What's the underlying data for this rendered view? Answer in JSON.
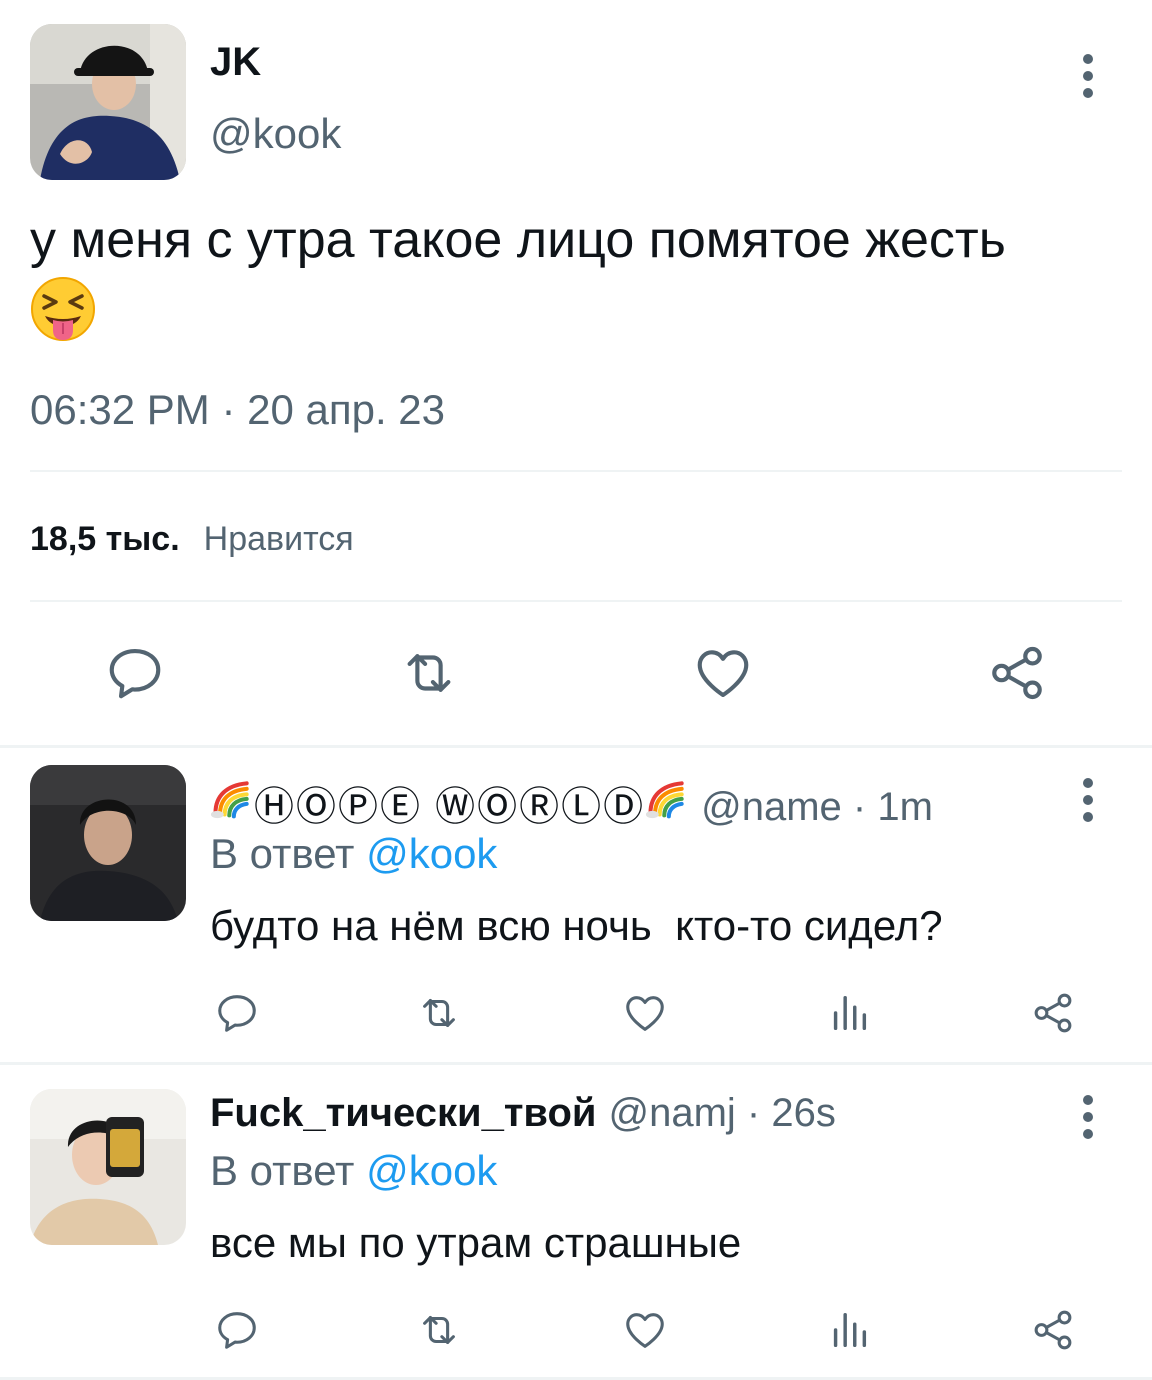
{
  "main_tweet": {
    "display_name": "JK",
    "handle": "@kook",
    "text": "у меня с утра такое лицо помятое жесть",
    "emoji": "squinting-face-with-tongue",
    "timestamp": "06:32 PM · 20 апр. 23",
    "likes_count": "18,5 тыс.",
    "likes_label": "Нравится"
  },
  "replies": [
    {
      "display_name": "ⒽⓄⓅⒺ ⓌⓄⓇⓁⒹ",
      "handle_time": "@name · 1m",
      "reply_to_prefix": "В ответ",
      "reply_to_handle": "@kook",
      "text": "будто на нём всю ночь  кто-то сидел?"
    },
    {
      "display_name": "Fuck_тически_твой",
      "handle_time": "@namj · 26s",
      "reply_to_prefix": "В ответ",
      "reply_to_handle": "@kook",
      "text": "все мы по утрам страшные"
    }
  ],
  "icons": [
    "reply-icon",
    "retweet-icon",
    "like-icon",
    "views-icon",
    "share-icon",
    "more-icon",
    "rainbow-icon"
  ],
  "colors": {
    "text": "#0f1419",
    "secondary": "#536471",
    "mention": "#1d9bf0",
    "divider": "#eff3f4"
  }
}
